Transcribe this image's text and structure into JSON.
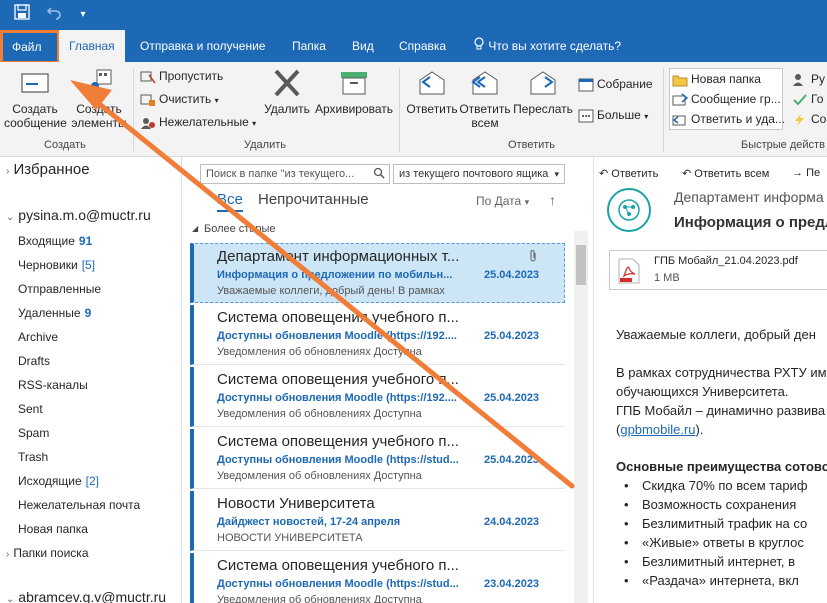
{
  "quickaccess": {
    "save_icon": "save-icon",
    "undo_icon": "undo-icon",
    "more_icon": "▾"
  },
  "tabs": {
    "file": "Файл",
    "items": [
      "Главная",
      "Отправка и получение",
      "Папка",
      "Вид",
      "Справка"
    ],
    "tellme": "Что вы хотите сделать?"
  },
  "ribbon": {
    "create": {
      "new_message": "Создать\nсообщение",
      "new_items": "Создать\nэлементы",
      "label": "Создать"
    },
    "delete": {
      "ignore": "Пропустить",
      "clean": "Очистить",
      "junk": "Нежелательные",
      "delete": "Удалить",
      "archive": "Архивировать",
      "label": "Удалить"
    },
    "respond": {
      "reply": "Ответить",
      "reply_all": "Ответить\nвсем",
      "forward": "Переслать",
      "meeting": "Собрание",
      "more": "Больше",
      "label": "Ответить"
    },
    "quicksteps": {
      "item1": "Новая папка",
      "item2": "Сообщение гр...",
      "item3": "Ответить и уда...",
      "label": "Быстрые действ"
    },
    "move": {
      "item1": "Ру",
      "item2": "Го",
      "item3": "Со"
    }
  },
  "folders": {
    "favorites": "Избранное",
    "account": "pysina.m.o@muctr.ru",
    "items": [
      {
        "name": "Входящие",
        "count": "91",
        "style": "bold"
      },
      {
        "name": "Черновики",
        "count": "[5]",
        "style": "bracket"
      },
      {
        "name": "Отправленные",
        "count": "",
        "style": ""
      },
      {
        "name": "Удаленные",
        "count": "9",
        "style": "bold"
      },
      {
        "name": "Archive",
        "count": "",
        "style": ""
      },
      {
        "name": "Drafts",
        "count": "",
        "style": ""
      },
      {
        "name": "RSS-каналы",
        "count": "",
        "style": ""
      },
      {
        "name": "Sent",
        "count": "",
        "style": ""
      },
      {
        "name": "Spam",
        "count": "",
        "style": ""
      },
      {
        "name": "Trash",
        "count": "",
        "style": ""
      },
      {
        "name": "Исходящие",
        "count": "[2]",
        "style": "bracket"
      },
      {
        "name": "Нежелательная почта",
        "count": "",
        "style": ""
      },
      {
        "name": "Новая папка",
        "count": "",
        "style": ""
      },
      {
        "name": "Папки поиска",
        "count": "",
        "style": ""
      }
    ],
    "account2": "abramcev.g.v@muctr.ru"
  },
  "list": {
    "search_placeholder": "Поиск в папке \"из текущего...",
    "scope": "из текущего почтового ящика",
    "filter_all": "Все",
    "filter_unread": "Непрочитанные",
    "sort": "По Дата",
    "group": "Более старые",
    "messages": [
      {
        "from": "Департамент информационных т...",
        "subject": "Информация о предложении по мобильн...",
        "preview": "Уважаемые коллеги, добрый день!  В рамках",
        "date": "25.04.2023",
        "attachment": true,
        "selected": true
      },
      {
        "from": "Система оповещения учебного п...",
        "subject": "Доступны обновления Moodle (https://192....",
        "preview": "Уведомления об обновлениях  Доступна",
        "date": "25.04.2023",
        "attachment": false,
        "selected": false
      },
      {
        "from": "Система оповещения учебного п...",
        "subject": "Доступны обновления Moodle (https://192....",
        "preview": "Уведомления об обновлениях  Доступна",
        "date": "25.04.2023",
        "attachment": false,
        "selected": false
      },
      {
        "from": "Система оповещения учебного п...",
        "subject": "Доступны обновления Moodle (https://stud...",
        "preview": "Уведомления об обновлениях  Доступна",
        "date": "25.04.2023",
        "attachment": false,
        "selected": false
      },
      {
        "from": "Новости Университета",
        "subject": "Дайджест новостей, 17-24 апреля",
        "preview": "НОВОСТИ УНИВЕРСИТЕТА",
        "date": "24.04.2023",
        "attachment": false,
        "selected": false
      },
      {
        "from": "Система оповещения учебного п...",
        "subject": "Доступны обновления Moodle (https://stud...",
        "preview": "Уведомления об обновлениях  Доступна",
        "date": "23.04.2023",
        "attachment": false,
        "selected": false
      }
    ]
  },
  "reading": {
    "reply": "Ответить",
    "reply_all": "Ответить всем",
    "forward": "Пе",
    "sender": "Департамент информа",
    "subject": "Информация о предл",
    "attachment_name": "ГПБ Мобайл_21.04.2023.pdf",
    "attachment_size": "1 MB",
    "body": [
      "Уважаемые коллеги, добрый ден",
      "В рамках сотрудничества РХТУ им",
      "обучающихся Университета.",
      "ГПБ Мобайл – динамично развива",
      "(gpbmobile.ru).",
      "Основные преимущества сотово"
    ],
    "link": "gpbmobile.ru",
    "bullets": [
      "Скидка 70% по всем тариф",
      "Возможность сохранения",
      "Безлимитный трафик на со",
      "«Живые» ответы в круглос",
      "Безлимитный интернет, в",
      "«Раздача» интернета, вкл"
    ]
  },
  "colors": {
    "brand": "#1d69b6",
    "highlight": "#f07d38",
    "selected": "#cde6f7"
  }
}
